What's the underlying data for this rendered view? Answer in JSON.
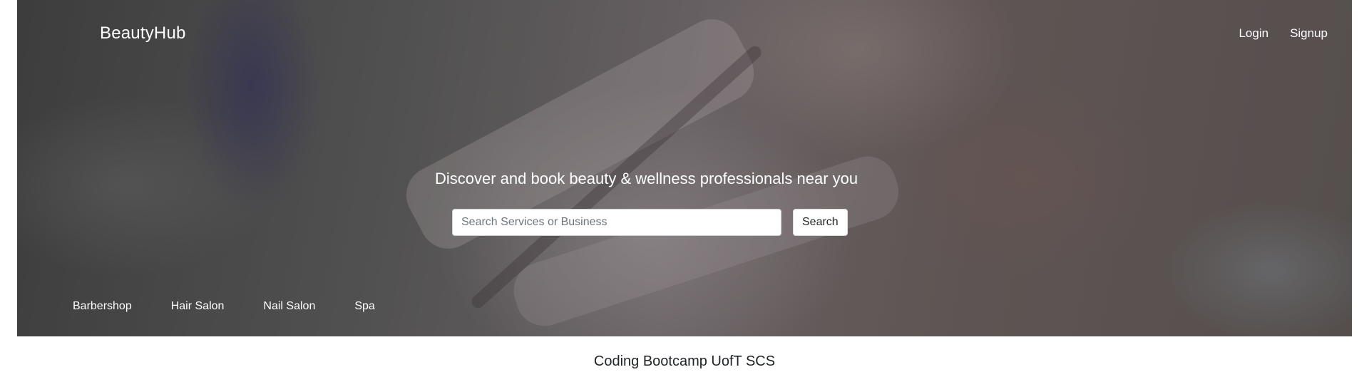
{
  "navbar": {
    "brand": "BeautyHub",
    "links": [
      "Login",
      "Signup"
    ]
  },
  "hero": {
    "tagline": "Discover and book beauty & wellness professionals near you",
    "search": {
      "placeholder": "Search Services or Business",
      "value": "",
      "button_label": "Search"
    },
    "categories": [
      "Barbershop",
      "Hair Salon",
      "Nail Salon",
      "Spa"
    ]
  },
  "footer": {
    "text": "Coding Bootcamp UofT SCS"
  },
  "colors": {
    "text_on_hero": "#ffffff",
    "footer_text": "#212529",
    "page_background": "#ffffff"
  }
}
